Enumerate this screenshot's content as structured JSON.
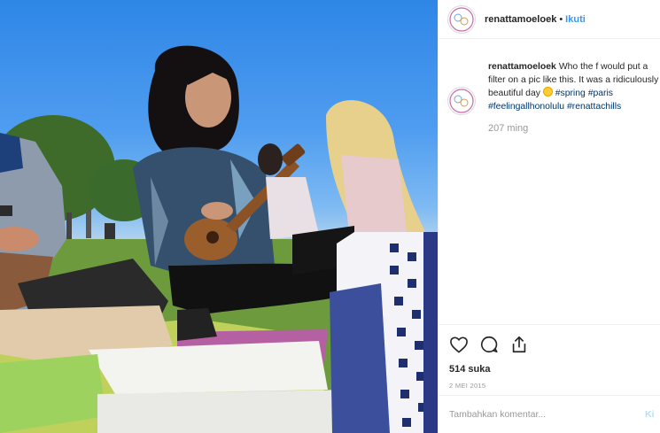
{
  "post": {
    "photo_alt": "",
    "header": {
      "username": "renattamoeloek",
      "separator": "•",
      "follow_label": "Ikuti"
    },
    "caption": {
      "username": "renattamoeloek",
      "text": "Who the f would put a filter on a pic like this. It was a ridiculously beautiful day",
      "emoji_icon": "sun-emoji",
      "hashtags": [
        "#spring",
        "#paris",
        "#feelingallhonolulu",
        "#renattachills"
      ],
      "time_ago": "207 ming"
    },
    "actions": {
      "like_icon": "heart-icon",
      "comment_icon": "comment-icon",
      "share_icon": "share-icon"
    },
    "likes": "514 suka",
    "date": "2 MEI 2015",
    "add_comment": {
      "placeholder": "Tambahkan komentar...",
      "post_label": "Ki"
    }
  },
  "colors": {
    "accent": "#3897f0",
    "hashtag": "#003569",
    "muted": "#999999",
    "border": "#efefef",
    "sky": "#2e86e6",
    "grass": "#6f9a3c"
  }
}
